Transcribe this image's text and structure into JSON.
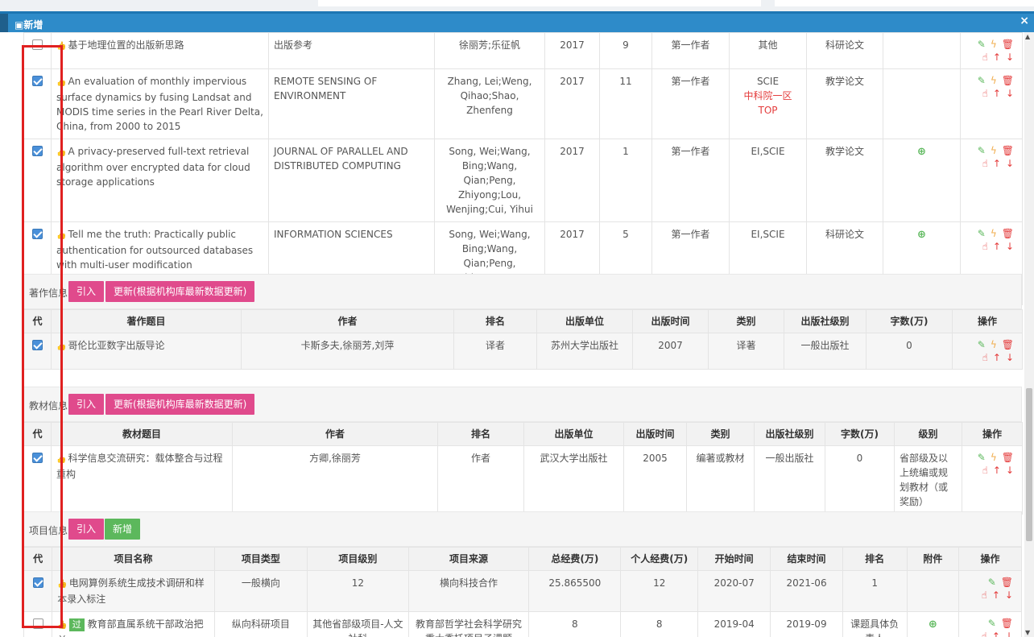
{
  "dialog": {
    "title": "新增",
    "close": "×"
  },
  "papers": [
    {
      "checked": false,
      "title": "基于地理位置的出版新思路",
      "journal": "出版参考",
      "authors": "徐丽芳;乐征帆",
      "year": "2017",
      "issue": "9",
      "role": "第一作者",
      "index": "其他",
      "index2": "",
      "type": "科研论文",
      "att": false
    },
    {
      "checked": true,
      "title": "An evaluation of monthly impervious surface dynamics by fusing Landsat and MODIS time series in the Pearl River Delta, China, from 2000 to 2015",
      "journal": "REMOTE SENSING OF ENVIRONMENT",
      "authors": "Zhang, Lei;Weng, Qihao;Shao, Zhenfeng",
      "year": "2017",
      "issue": "11",
      "role": "第一作者",
      "index": "SCIE",
      "index2": "中科院一区TOP",
      "type": "教学论文",
      "att": false
    },
    {
      "checked": true,
      "title": "A privacy-preserved full-text retrieval algorithm over encrypted data for cloud storage applications",
      "journal": "JOURNAL OF PARALLEL AND DISTRIBUTED COMPUTING",
      "authors": "Song, Wei;Wang, Bing;Wang, Qian;Peng, Zhiyong;Lou, Wenjing;Cui, Yihui",
      "year": "2017",
      "issue": "1",
      "role": "第一作者",
      "index": "EI,SCIE",
      "index2": "",
      "type": "教学论文",
      "att": true
    },
    {
      "checked": true,
      "title": "Tell me the truth: Practically public authentication for outsourced databases with multi-user modification",
      "journal": "INFORMATION SCIENCES",
      "authors": "Song, Wei;Wang, Bing;Wang, Qian;Peng, Zhiyong;Lou, Wenjing",
      "year": "2017",
      "issue": "5",
      "role": "第一作者",
      "index": "EI,SCIE",
      "index2": "",
      "type": "科研论文",
      "att": true
    }
  ],
  "works": {
    "label": "著作信息",
    "btn_import": "引入",
    "btn_update": "更新(根据机构库最新数据更新)",
    "headers": [
      "代",
      "著作题目",
      "作者",
      "排名",
      "出版单位",
      "出版时间",
      "类别",
      "出版社级别",
      "字数(万)",
      "操作"
    ],
    "rows": [
      {
        "checked": true,
        "title": "哥伦比亚数字出版导论",
        "authors": "卡斯多夫,徐丽芳,刘萍",
        "rank": "译者",
        "publisher": "苏州大学出版社",
        "time": "2007",
        "cat": "译著",
        "level": "一般出版社",
        "words": "0"
      }
    ]
  },
  "textbooks": {
    "label": "教材信息",
    "btn_import": "引入",
    "btn_update": "更新(根据机构库最新数据更新)",
    "headers": [
      "代",
      "教材题目",
      "作者",
      "排名",
      "出版单位",
      "出版时间",
      "类别",
      "出版社级别",
      "字数(万)",
      "级别",
      "操作"
    ],
    "rows": [
      {
        "checked": true,
        "title": "科学信息交流研究：载体整合与过程重构",
        "authors": "方卿,徐丽芳",
        "rank": "作者",
        "publisher": "武汉大学出版社",
        "time": "2005",
        "cat": "编著或教材",
        "level": "一般出版社",
        "words": "0",
        "grade": "省部级及以上统编或规划教材（或奖励）"
      }
    ]
  },
  "projects": {
    "label": "项目信息",
    "btn_import": "引入",
    "btn_add": "新增",
    "headers": [
      "代",
      "项目名称",
      "项目类型",
      "项目级别",
      "项目来源",
      "总经费(万)",
      "个人经费(万)",
      "开始时间",
      "结束时间",
      "排名",
      "附件",
      "操作"
    ],
    "rows": [
      {
        "checked": true,
        "name": "电网算例系统生成技术调研和样本录入标注",
        "type": "一般横向",
        "level": "12",
        "source": "横向科技合作",
        "total": "25.865500",
        "personal": "12",
        "start": "2020-07",
        "end": "2021-06",
        "rank": "1",
        "att": false,
        "badge": ""
      },
      {
        "checked": false,
        "name": "教育部直属系统干部政治把关",
        "type": "纵向科研项目",
        "level": "其他省部级项目-人文社科",
        "source": "教育部哲学社会科学研究重大委托项目子课题",
        "total": "8",
        "personal": "8",
        "start": "2019-04",
        "end": "2019-09",
        "rank": "课题具体负责人",
        "att": true,
        "badge": "过"
      }
    ]
  },
  "icons": {
    "edit": "✎",
    "act": "ϟ",
    "del": "🗑",
    "like": "☝",
    "up": "↑",
    "down": "↓",
    "att": "⊕"
  },
  "colors": {
    "titlebar": "#2e8bc9",
    "pink": "#e04a8c",
    "green": "#5cb85c",
    "red": "#e43c3c",
    "highlight": "#e02020"
  }
}
